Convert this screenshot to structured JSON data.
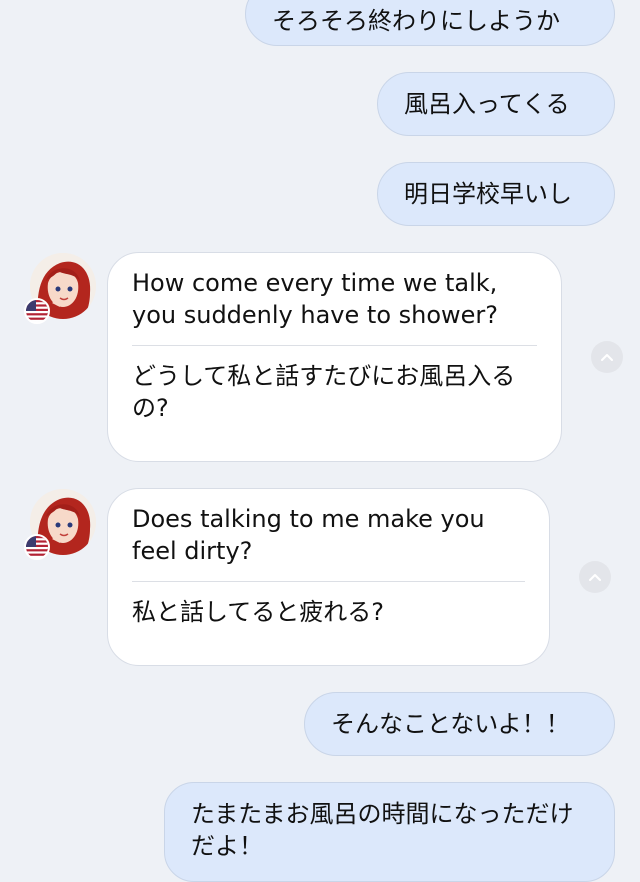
{
  "chat": {
    "messages": [
      {
        "direction": "outgoing",
        "text": "そろそろ終わりにしようか"
      },
      {
        "direction": "outgoing",
        "text": "風呂入ってくる"
      },
      {
        "direction": "outgoing",
        "text": "明日学校早いし"
      },
      {
        "direction": "incoming",
        "original": "How come every time we talk, you suddenly have to shower?",
        "translation": "どうして私と話すたびにお風呂入るの?",
        "avatar_icon": "red-haired-girl-avatar-icon",
        "flag_icon": "us-flag-icon",
        "toggle_icon": "chevron-up-icon"
      },
      {
        "direction": "incoming",
        "original": "Does talking to me make you feel dirty?",
        "translation": "私と話してると疲れる?",
        "avatar_icon": "red-haired-girl-avatar-icon",
        "flag_icon": "us-flag-icon",
        "toggle_icon": "chevron-up-icon"
      },
      {
        "direction": "outgoing",
        "text": "そんなことないよ！！"
      },
      {
        "direction": "outgoing",
        "text": "たまたまお風呂の時間になっただけだよ！"
      }
    ]
  },
  "colors": {
    "background": "#eef1f6",
    "outgoing_bubble": "#dce8fb",
    "incoming_bubble": "#ffffff"
  }
}
